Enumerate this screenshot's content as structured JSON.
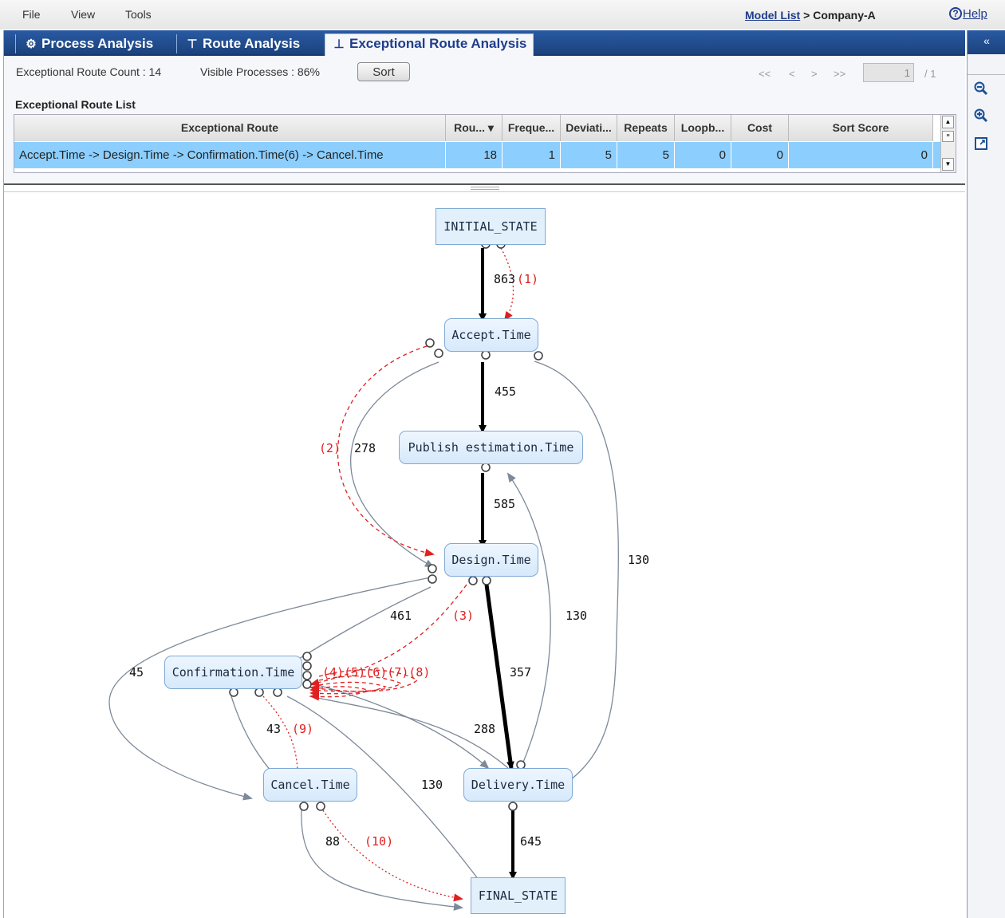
{
  "menu": {
    "file": "File",
    "view": "View",
    "tools": "Tools"
  },
  "breadcrumb": {
    "link": "Model List",
    "separator": ">",
    "current": "Company-A"
  },
  "help": {
    "label": "Help"
  },
  "tabs": [
    {
      "label": "Process Analysis",
      "icon": "process-icon"
    },
    {
      "label": "Route Analysis",
      "icon": "route-icon"
    },
    {
      "label": "Exceptional Route Analysis",
      "icon": "exceptional-icon"
    }
  ],
  "stats": {
    "count_label": "Exceptional Route Count : 14",
    "visible_label": "Visible Processes : 86%"
  },
  "sort_button": "Sort",
  "pager": {
    "first": "<<",
    "prev": "<",
    "next": ">",
    "last": ">>",
    "page": "1",
    "of": "/  1"
  },
  "list_title": "Exceptional Route List",
  "table": {
    "headers": [
      "Exceptional Route",
      "Rou... ▾",
      "Freque...",
      "Deviati...",
      "Repeats",
      "Loopb...",
      "Cost",
      "Sort Score"
    ],
    "rows": [
      [
        "Accept.Time -> Design.Time -> Confirmation.Time(6) -> Cancel.Time",
        "18",
        "1",
        "5",
        "5",
        "0",
        "0",
        "0"
      ]
    ]
  },
  "graph": {
    "nodes": {
      "initial": "INITIAL_STATE",
      "accept": "Accept.Time",
      "publish": "Publish estimation.Time",
      "design": "Design.Time",
      "confirm": "Confirmation.Time",
      "cancel": "Cancel.Time",
      "delivery": "Delivery.Time",
      "final": "FINAL_STATE"
    },
    "edge_labels": {
      "initial_accept": "863",
      "initial_accept_ex": "(1)",
      "accept_publish": "455",
      "accept_design_ex": "(2)",
      "accept_design": "278",
      "publish_design": "585",
      "accept_delivery": "130",
      "delivery_publish": "130",
      "design_confirm": "461",
      "design_confirm_ex": "(3)",
      "design_cancel": "45",
      "design_delivery": "357",
      "confirm_self_ex": "(4)(5)(6)(7)(8)",
      "confirm_cancel": "43",
      "confirm_cancel_ex": "(9)",
      "confirm_delivery": "288",
      "confirm_final": "130",
      "cancel_final": "88",
      "cancel_final_ex": "(10)",
      "delivery_final": "645"
    }
  },
  "colors": {
    "accent": "#1b427d",
    "selected_row": "#8ccfff",
    "exceptional_edge": "#e02020",
    "edge": "#7d8a99"
  },
  "sidebar": {
    "collapse": "«"
  }
}
